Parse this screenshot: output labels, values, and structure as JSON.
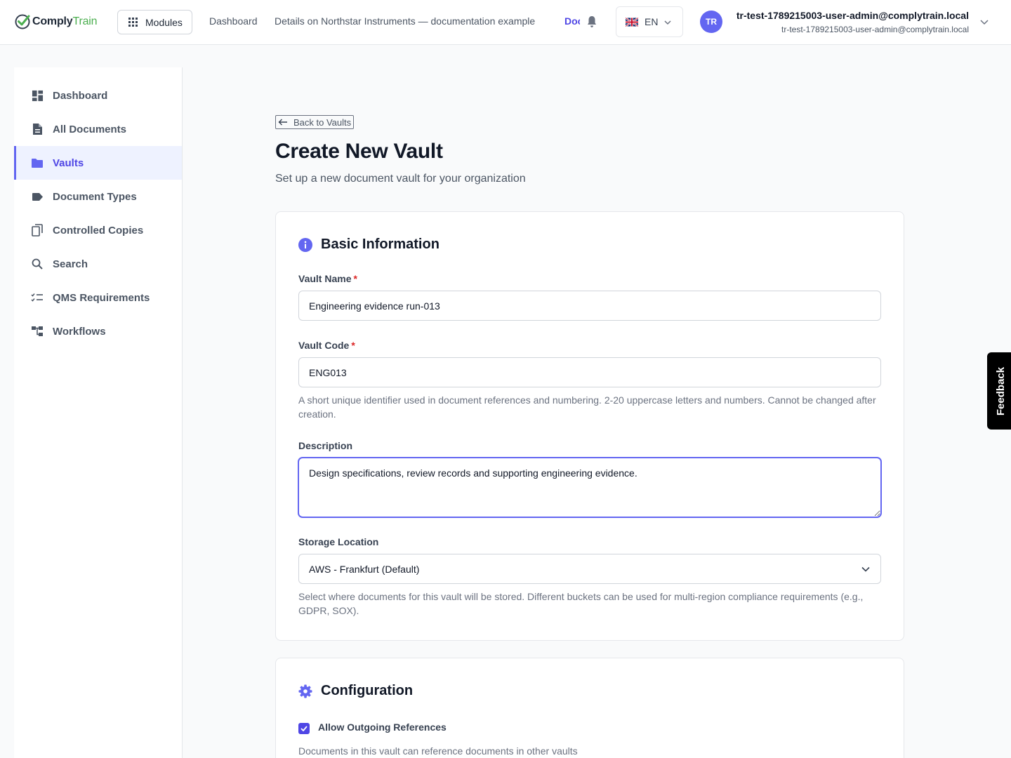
{
  "brand": {
    "name_part1": "Comply",
    "name_part2": "Train"
  },
  "topbar": {
    "modules_label": "Modules",
    "nav": [
      "Dashboard",
      "Details on Northstar Instruments — documentation example",
      "Documents"
    ],
    "language": "EN",
    "avatar_initials": "TR",
    "user_name": "tr-test-1789215003-user-admin@complytrain.local",
    "user_email": "tr-test-1789215003-user-admin@complytrain.local"
  },
  "sidebar": {
    "items": [
      {
        "label": "Dashboard",
        "icon": "dashboard-icon"
      },
      {
        "label": "All Documents",
        "icon": "document-icon"
      },
      {
        "label": "Vaults",
        "icon": "folder-icon",
        "active": true
      },
      {
        "label": "Document Types",
        "icon": "tag-icon"
      },
      {
        "label": "Controlled Copies",
        "icon": "copies-icon"
      },
      {
        "label": "Search",
        "icon": "search-icon"
      },
      {
        "label": "QMS Requirements",
        "icon": "checklist-icon"
      },
      {
        "label": "Workflows",
        "icon": "workflow-icon"
      }
    ]
  },
  "page": {
    "back_label": "Back to Vaults",
    "title": "Create New Vault",
    "subtitle": "Set up a new document vault for your organization"
  },
  "basic": {
    "heading": "Basic Information",
    "name_label": "Vault Name",
    "name_value": "Engineering evidence run-013",
    "code_label": "Vault Code",
    "code_value": "ENG013",
    "code_help": "A short unique identifier used in document references and numbering. 2-20 uppercase letters and numbers. Cannot be changed after creation.",
    "desc_label": "Description",
    "desc_value": "Design specifications, review records and supporting engineering evidence.",
    "storage_label": "Storage Location",
    "storage_value": "AWS - Frankfurt (Default)",
    "storage_help": "Select where documents for this vault will be stored. Different buckets can be used for multi-region compliance requirements (e.g., GDPR, SOX).",
    "required_mark": "*"
  },
  "config": {
    "heading": "Configuration",
    "allow_outgoing_label": "Allow Outgoing References",
    "allow_outgoing_checked": true,
    "allow_outgoing_help": "Documents in this vault can reference documents in other vaults"
  },
  "feedback_label": "Feedback",
  "colors": {
    "accent": "#4f46e5",
    "brand_green": "#4caf50",
    "avatar": "#6366f1"
  }
}
